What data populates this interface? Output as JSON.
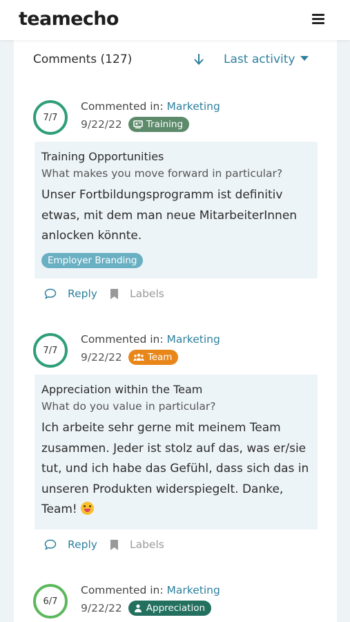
{
  "header": {
    "logo": "teamecho"
  },
  "comments_section": {
    "heading": "Comments (127)",
    "sort_label": "Last activity"
  },
  "comments": [
    {
      "score": "7/7",
      "commented_in_prefix": "Commented in: ",
      "commented_in": "Marketing",
      "date": "9/22/22",
      "category": "Training",
      "category_color": "#5c8a6a",
      "topic": "Training Opportunities",
      "question": "What makes you move forward in particular?",
      "text": "Unser Fortbildungsprogramm ist definitiv etwas, mit dem man neue MitarbeiterInnen anlocken könnte.",
      "label": "Employer Branding",
      "reply": "Reply",
      "labels": "Labels"
    },
    {
      "score": "7/7",
      "commented_in_prefix": "Commented in: ",
      "commented_in": "Marketing",
      "date": "9/22/22",
      "category": "Team",
      "category_color": "#e8861a",
      "topic": "Appreciation within the Team",
      "question": "What do you value in particular?",
      "text": "Ich arbeite sehr gerne mit meinem Team zusammen. Jeder ist stolz auf das, was er/sie tut, und ich habe das Gefühl, dass sich das in unseren Produkten widerspiegelt. Danke, Team!",
      "reply": "Reply",
      "labels": "Labels"
    },
    {
      "score": "6/7",
      "commented_in_prefix": "Commented in: ",
      "commented_in": "Marketing",
      "date": "9/22/22",
      "category": "Appreciation",
      "category_color": "#23705f"
    }
  ],
  "colors": {
    "accent": "#2d7f9d",
    "ring_full": "#2e9e78",
    "ring_partial": "#5cb85c"
  }
}
